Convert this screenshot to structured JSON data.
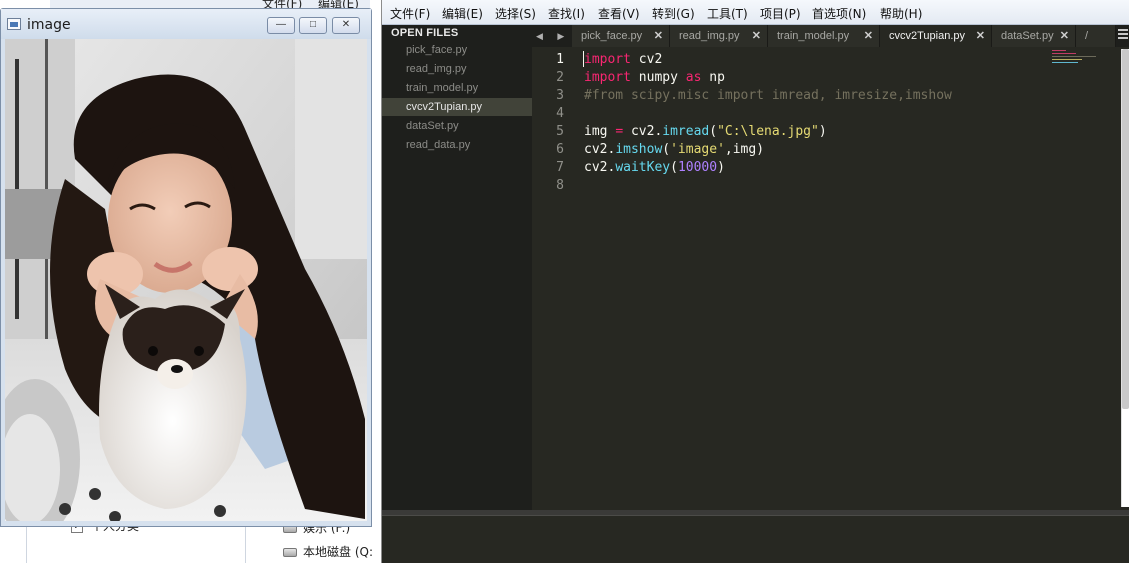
{
  "background_explorer": {
    "menu_partial": [
      "文件(F)",
      "编辑(E)"
    ],
    "nav_items": [
      {
        "label": "个人分类",
        "type": "checkbox"
      },
      {
        "label": "娱乐 (F:)",
        "type": "drive"
      },
      {
        "label": "本地磁盘 (Q:",
        "type": "drive"
      }
    ]
  },
  "image_window": {
    "title": "image",
    "controls": {
      "minimize": "—",
      "maximize": "□",
      "close": "✕"
    }
  },
  "sublime": {
    "menu": [
      "文件(F)",
      "编辑(E)",
      "选择(S)",
      "查找(I)",
      "查看(V)",
      "转到(G)",
      "工具(T)",
      "项目(P)",
      "首选项(N)",
      "帮助(H)"
    ],
    "sidebar_header": "OPEN FILES",
    "open_files": [
      "pick_face.py",
      "read_img.py",
      "train_model.py",
      "cvcv2Tupian.py",
      "dataSet.py",
      "read_data.py"
    ],
    "active_file": "cvcv2Tupian.py",
    "tab_nav": "◀ ▶",
    "tabs": [
      {
        "label": "pick_face.py",
        "close": "✕"
      },
      {
        "label": "read_img.py",
        "close": "✕"
      },
      {
        "label": "train_model.py",
        "close": "✕"
      },
      {
        "label": "cvcv2Tupian.py",
        "close": "✕",
        "active": true
      },
      {
        "label": "dataSet.py",
        "close": "✕"
      },
      {
        "label": "/",
        "close": ""
      }
    ],
    "line_numbers": [
      "1",
      "2",
      "3",
      "4",
      "5",
      "6",
      "7",
      "8"
    ],
    "current_line": 1,
    "code": {
      "l1_kw": "import",
      "l1_rest": " cv2",
      "l2_kw": "import",
      "l2_a": " numpy ",
      "l2_as": "as",
      "l2_b": " np",
      "l3_comment": "#from scipy.misc import imread, imresize,imshow",
      "l5_a": "img ",
      "l5_eq": "=",
      "l5_b": " cv2.",
      "l5_fn": "imread",
      "l5_c": "(",
      "l5_str": "\"C:\\lena.jpg\"",
      "l5_d": ")",
      "l6_a": "cv2.",
      "l6_fn": "imshow",
      "l6_b": "(",
      "l6_str": "'image'",
      "l6_c": ",img)",
      "l7_a": "cv2.",
      "l7_fn": "waitKey",
      "l7_b": "(",
      "l7_num": "10000",
      "l7_c": ")"
    },
    "theme_colors": {
      "background": "#272822",
      "keyword": "#f92672",
      "comment": "#75715e",
      "function": "#66d9ef",
      "string": "#e6db74",
      "number": "#ae81ff"
    }
  }
}
